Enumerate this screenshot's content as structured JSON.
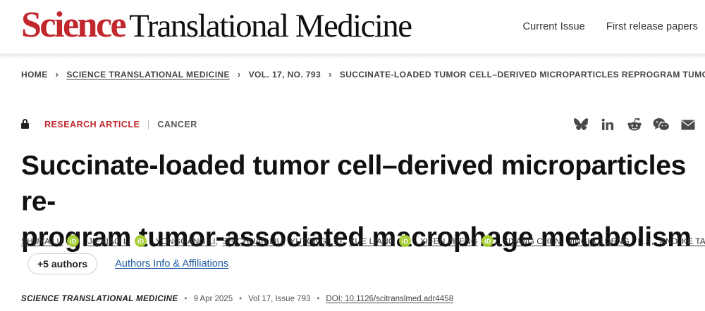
{
  "header": {
    "logo_brand": "Science",
    "logo_rest": "Translational Medicine",
    "nav": [
      "Current Issue",
      "First release papers"
    ],
    "brand_color": "#c1272d"
  },
  "breadcrumb": {
    "items": [
      {
        "label": "HOME",
        "link": false
      },
      {
        "label": "SCIENCE TRANSLATIONAL MEDICINE",
        "link": true
      },
      {
        "label": "VOL. 17, NO. 793",
        "link": false
      },
      {
        "label": "SUCCINATE-LOADED TUMOR CELL–DERIVED MICROPARTICLES REPROGRAM TUMOR-...",
        "link": false
      }
    ]
  },
  "article": {
    "lock_icon": "lock-icon",
    "type": "RESEARCH ARTICLE",
    "topic": "CANCER",
    "title": "Succinate-loaded tumor cell–derived microparticles re-program tumor-associated macrophage metabolism",
    "title_line1": "Succinate-loaded tumor cell–derived microparticles re-",
    "title_line2": "program tumor-associated macrophage metabolism"
  },
  "share": {
    "icons": [
      "bluesky-icon",
      "linkedin-icon",
      "reddit-icon",
      "wechat-icon",
      "email-icon"
    ]
  },
  "authors": {
    "list": [
      {
        "name": "SHUYA LU",
        "orcid": true
      },
      {
        "name": "JIEXIAO LI",
        "orcid": true
      },
      {
        "name": "YONGGANG LI",
        "orcid": false
      },
      {
        "name": "SHICHUAN LIU",
        "orcid": false
      },
      {
        "name": "YUTONG LIU",
        "orcid": false
      },
      {
        "name": "YUE LIANG",
        "orcid": true
      },
      {
        "name": "XIFEN ZHENG",
        "orcid": true
      },
      {
        "name": "YIYANG CHEN",
        "orcid": false
      },
      {
        "name": "JINGHUI DENG",
        "orcid": false
      }
    ],
    "ellipsis": "[...]",
    "and_label": "AND",
    "last": {
      "name": "KE TANG",
      "orcid": true
    },
    "orcid_label": "iD",
    "more_button": "+5 authors",
    "affiliations_link": "Authors Info & Affiliations"
  },
  "citation": {
    "journal": "SCIENCE TRANSLATIONAL MEDICINE",
    "date": "9 Apr 2025",
    "volume": "Vol 17, Issue 793",
    "doi": "DOI: 10.1126/scitranslmed.adr4458"
  }
}
